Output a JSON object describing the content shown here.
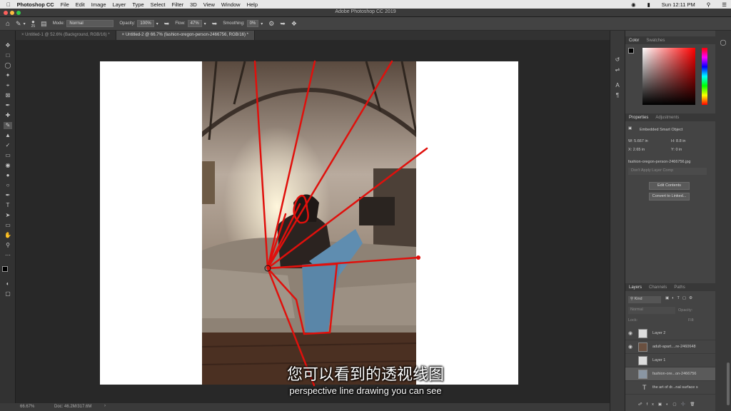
{
  "mac_menu": {
    "app": "Photoshop CC",
    "items": [
      "File",
      "Edit",
      "Image",
      "Layer",
      "Type",
      "Select",
      "Filter",
      "3D",
      "View",
      "Window",
      "Help"
    ],
    "clock": "Sun 12:11 PM"
  },
  "window_title": "Adobe Photoshop CC 2019",
  "options": {
    "brush_size": "25",
    "mode_label": "Mode:",
    "mode_value": "Normal",
    "opacity_label": "Opacity:",
    "opacity_value": "100%",
    "flow_label": "Flow:",
    "flow_value": "47%",
    "smoothing_label": "Smoothing:",
    "smoothing_value": "0%"
  },
  "tabs": [
    {
      "label": "Untitled-1 @ 52.6% (Background, RGB/16) *"
    },
    {
      "label": "Untitled-2 @ 66.7% (fashion-oregon-person-2466756, RGB/16) *"
    }
  ],
  "status": {
    "zoom": "66.67%",
    "doc": "Doc: 46.2M/317.6M"
  },
  "color_panel": {
    "tabs": [
      "Color",
      "Swatches"
    ]
  },
  "properties": {
    "tabs": [
      "Properties",
      "Adjustments"
    ],
    "type": "Embedded Smart Object",
    "w_label": "W:",
    "w_value": "5.667 in",
    "h_label": "H:",
    "h_value": "8.8 in",
    "x_label": "X:",
    "x_value": "2.65 in",
    "y_label": "Y:",
    "y_value": "0 in",
    "filename": "fashion-oregon-person-2466756.jpg",
    "layer_comp": "Don't Apply Layer Comp",
    "edit_button": "Edit Contents",
    "convert_button": "Convert to Linked..."
  },
  "layers": {
    "tabs": [
      "Layers",
      "Channels",
      "Paths"
    ],
    "filter": "Kind",
    "blend": "Normal",
    "opacity_label": "Opacity:",
    "lock_label": "Lock:",
    "fill_label": "Fill:",
    "items": [
      {
        "name": "Layer 2"
      },
      {
        "name": "adult-apart....re-2460648"
      },
      {
        "name": "Layer 1"
      },
      {
        "name": "fashion-ore...on-2466756"
      },
      {
        "name": "the art of dr...nal surface s"
      }
    ]
  },
  "subtitles": {
    "chinese": "您可以看到的透视线图",
    "english": "perspective line drawing you can see"
  }
}
